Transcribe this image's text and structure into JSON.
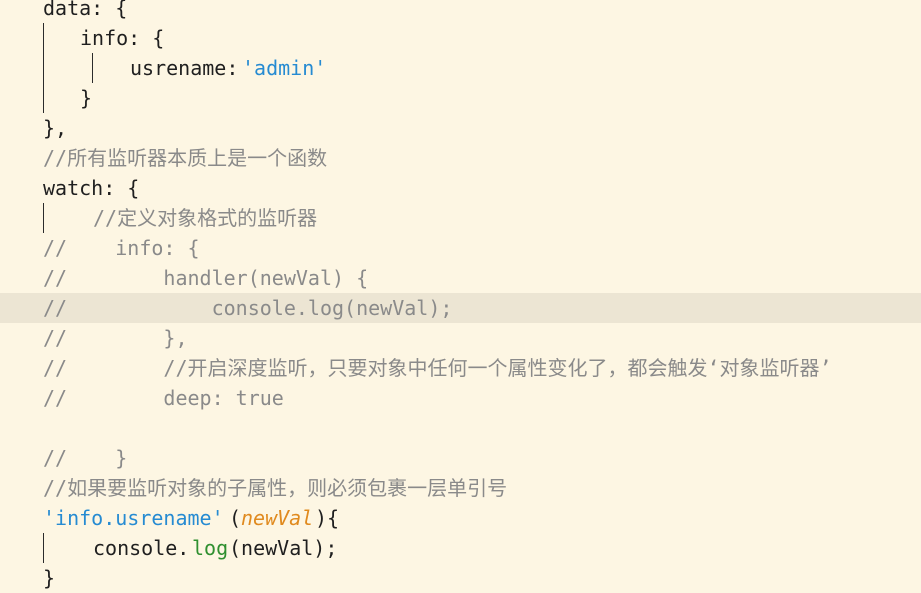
{
  "lines": [
    "data: {",
    "info: {",
    "usrename:",
    "'admin'",
    "}",
    "},",
    "//所有监听器本质上是一个函数",
    "watch: {",
    "//定义对象格式的监听器",
    "//    info: {",
    "//        handler(newVal) {",
    "//            console.log(newVal);",
    "//        },",
    "//        //开启深度监听，只要对象中任何一个属性变化了，都会触发‘对象监听器’",
    "//        deep: true",
    "//    }",
    "//如果要监听对象的子属性，则必须包裹一层单引号",
    "'info.usrename'",
    "(",
    "newVal",
    "){",
    "console.",
    "log",
    "(newVal);",
    "}"
  ],
  "theme": {
    "background": "#fdf6e3",
    "current_line": "#ece5d3",
    "comment": "#8a8a8a",
    "string": "#268bd2",
    "method": "#2f8f2f",
    "parameter": "#e08a1e"
  }
}
